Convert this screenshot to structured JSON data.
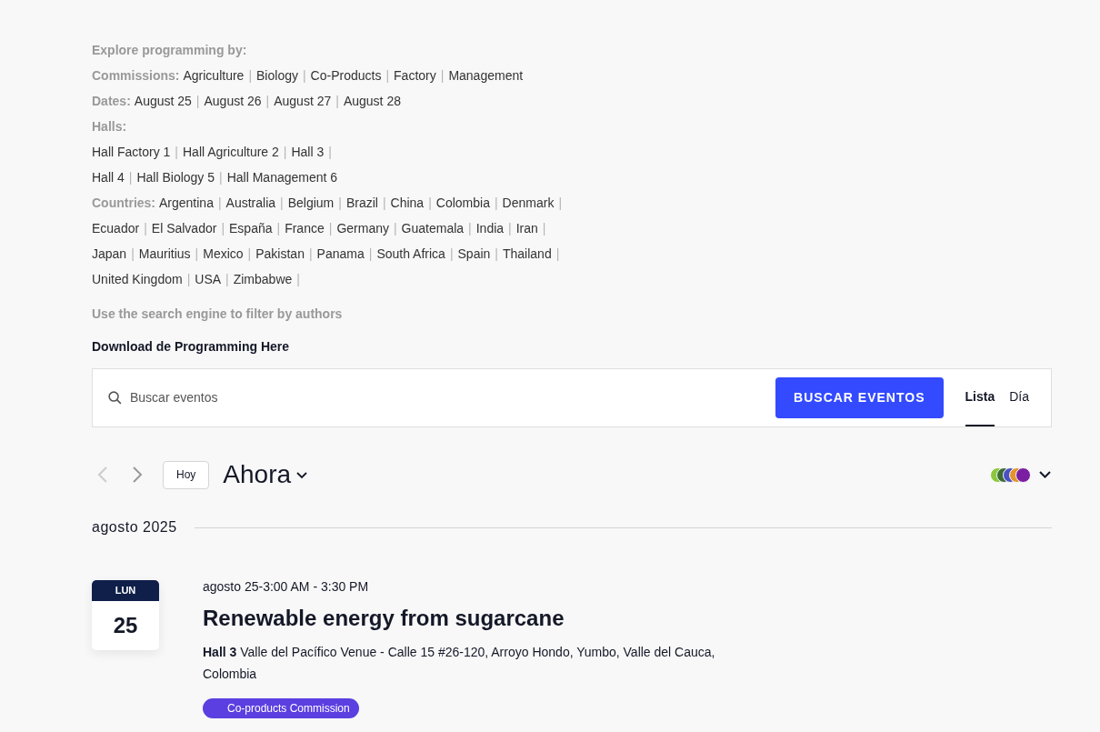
{
  "explore": {
    "heading": "Explore programming by:",
    "separator": "|",
    "lines": [
      {
        "label": "Commissions:",
        "links": [
          "Agriculture",
          "Biology",
          "Co-Products",
          "Factory",
          "Management"
        ],
        "trailing_separator": false
      },
      {
        "label": "Dates:",
        "links": [
          "August 25",
          "August 26",
          "August 27",
          "August 28"
        ],
        "trailing_separator": false
      },
      {
        "label": "Halls:",
        "trailing_separator": false
      },
      {
        "links": [
          "Hall Factory 1",
          "Hall Agriculture 2",
          "Hall 3"
        ],
        "trailing_separator": true
      },
      {
        "links": [
          "Hall 4",
          "Hall Biology 5",
          "Hall Management 6"
        ],
        "trailing_separator": false
      },
      {
        "label": "Countries:",
        "links": [
          "Argentina",
          "Australia",
          "Belgium",
          "Brazil",
          "China",
          "Colombia",
          "Denmark"
        ],
        "trailing_separator": true
      },
      {
        "links": [
          "Ecuador",
          "El Salvador",
          "España",
          "France",
          "Germany",
          "Guatemala",
          "India",
          "Iran"
        ],
        "trailing_separator": true
      },
      {
        "links": [
          "Japan",
          "Mauritius",
          "Mexico",
          "Pakistan",
          "Panama",
          "South Africa",
          "Spain",
          "Thailand"
        ],
        "trailing_separator": true
      },
      {
        "links": [
          "United Kingdom",
          "USA",
          "Zimbabwe"
        ],
        "trailing_separator": true
      }
    ],
    "hint": "Use the search engine to filter by authors",
    "download": "Download de Programming Here"
  },
  "search": {
    "placeholder": "Buscar eventos",
    "button": "BUSCAR EVENTOS"
  },
  "views": [
    {
      "label": "Lista",
      "selected": true
    },
    {
      "label": "Día",
      "selected": false
    }
  ],
  "nav": {
    "today": "Hoy",
    "period": "Ahora"
  },
  "legend": [
    {
      "color": "#8cc63f"
    },
    {
      "color": "#3d6b35"
    },
    {
      "color": "#4a4fc4"
    },
    {
      "color": "#e0952e"
    },
    {
      "color": "#7b1fa2"
    }
  ],
  "month": "agosto 2025",
  "events": [
    {
      "weekday": "LUN",
      "day": "25",
      "time": "agosto 25-3:00 AM - 3:30 PM",
      "title": "Renewable energy from sugarcane",
      "venue": "Hall 3",
      "address": "Valle del Pacífico Venue - Calle 15 #26-120, Arroyo Hondo, Yumbo, Valle del Cauca, Colombia",
      "tag": {
        "label": "Co-products Commission",
        "color": "#5b3fe0"
      }
    }
  ]
}
